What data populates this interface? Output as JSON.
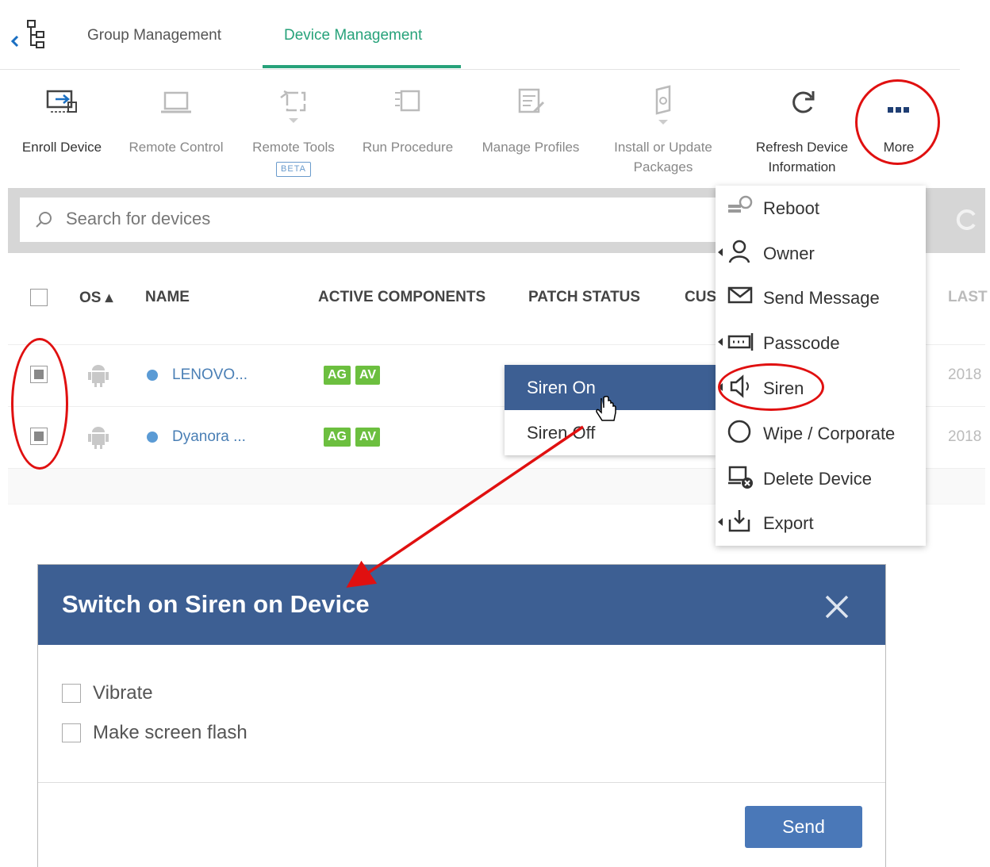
{
  "tabs": {
    "group_management": "Group Management",
    "device_management": "Device Management"
  },
  "toolbar": {
    "enroll_device": "Enroll Device",
    "remote_control": "Remote Control",
    "remote_tools": "Remote Tools",
    "remote_tools_badge": "BETA",
    "run_procedure": "Run Procedure",
    "manage_profiles": "Manage Profiles",
    "install_update_line1": "Install or Update",
    "install_update_line2": "Packages",
    "refresh_line1": "Refresh Device",
    "refresh_line2": "Information",
    "more": "More"
  },
  "search": {
    "placeholder": "Search for devices"
  },
  "table": {
    "headers": {
      "os": "OS ▴",
      "name": "NAME",
      "active_components": "ACTIVE COMPONENTS",
      "patch_status": "PATCH STATUS",
      "custom": "CUS",
      "last": "LAST"
    },
    "rows": [
      {
        "name": "LENOVO...",
        "badges": [
          "AG",
          "AV"
        ],
        "last": "2018"
      },
      {
        "name": "Dyanora ...",
        "badges": [
          "AG",
          "AV"
        ],
        "last": "2018"
      }
    ]
  },
  "siren_submenu": {
    "on": "Siren On",
    "off": "Siren Off"
  },
  "more_menu": {
    "items": [
      {
        "label": "Reboot",
        "icon": "reboot-icon"
      },
      {
        "label": "Owner",
        "icon": "owner-icon"
      },
      {
        "label": "Send Message",
        "icon": "envelope-icon"
      },
      {
        "label": "Passcode",
        "icon": "passcode-icon"
      },
      {
        "label": "Siren",
        "icon": "speaker-icon"
      },
      {
        "label": "Wipe / Corporate",
        "icon": "circle-icon"
      },
      {
        "label": "Delete Device",
        "icon": "delete-device-icon"
      },
      {
        "label": "Export",
        "icon": "export-icon"
      }
    ]
  },
  "modal": {
    "title": "Switch on Siren on Device",
    "options": [
      "Vibrate",
      "Make screen flash"
    ],
    "send": "Send"
  },
  "colors": {
    "accent_green": "#27a27a",
    "header_blue": "#3d5f93",
    "button_blue": "#4a78b8",
    "badge_green": "#6cbf3f",
    "annotation_red": "#e01010"
  }
}
